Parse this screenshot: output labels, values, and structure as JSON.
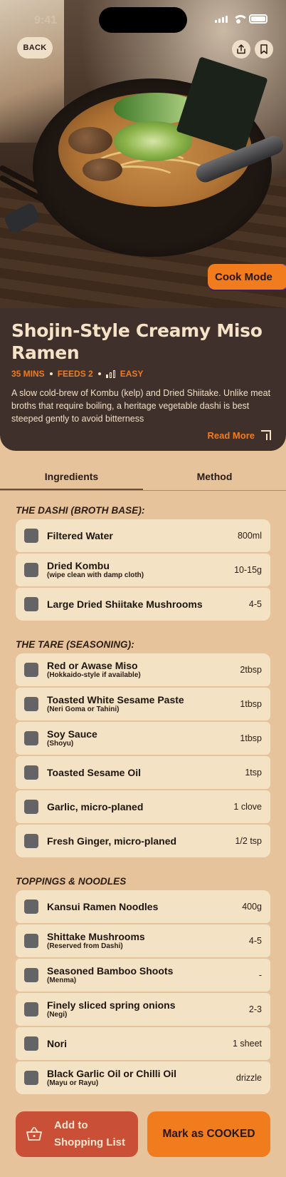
{
  "status_bar": {
    "time": "9:41"
  },
  "header": {
    "back_label": "BACK"
  },
  "hero": {
    "cook_mode_label": "Cook Mode"
  },
  "recipe": {
    "title": "Shojin-Style Creamy Miso Ramen",
    "time": "35 MINS",
    "feeds": "FEEDS 2",
    "difficulty": "EASY",
    "difficulty_level": 1,
    "description": "A slow cold-brew of Kombu (kelp) and Dried Shiitake. Unlike meat broths that require boiling, a heritage vegetable dashi is best steeped gently to avoid bitterness",
    "read_more_label": "Read More"
  },
  "tabs": [
    {
      "label": "Ingredients",
      "active": true
    },
    {
      "label": "Method",
      "active": false
    }
  ],
  "sections": [
    {
      "title": "THE DASHI (BROTH BASE):",
      "items": [
        {
          "name": "Filtered Water",
          "note": "",
          "qty": "800ml"
        },
        {
          "name": "Dried Kombu",
          "note": "(wipe clean with damp cloth)",
          "qty": "10-15g"
        },
        {
          "name": "Large Dried Shiitake Mushrooms",
          "note": "",
          "qty": "4-5"
        }
      ]
    },
    {
      "title": "THE TARE (SEASONING):",
      "items": [
        {
          "name": "Red or Awase Miso",
          "note": "(Hokkaido-style if available)",
          "qty": "2tbsp"
        },
        {
          "name": "Toasted White Sesame Paste",
          "note": "(Neri Goma or Tahini)",
          "qty": "1tbsp"
        },
        {
          "name": "Soy Sauce",
          "note": "(Shoyu)",
          "qty": "1tbsp"
        },
        {
          "name": "Toasted Sesame Oil",
          "note": "",
          "qty": "1tsp"
        },
        {
          "name": "Garlic, micro-planed",
          "note": "",
          "qty": "1 clove"
        },
        {
          "name": "Fresh Ginger, micro-planed",
          "note": "",
          "qty": "1/2 tsp"
        }
      ]
    },
    {
      "title": "TOPPINGS & NOODLES",
      "items": [
        {
          "name": "Kansui Ramen Noodles",
          "note": "",
          "qty": "400g"
        },
        {
          "name": "Shittake Mushrooms",
          "note": "(Reserved from Dashi)",
          "qty": "4-5"
        },
        {
          "name": "Seasoned Bamboo Shoots",
          "note": "(Menma)",
          "qty": "-"
        },
        {
          "name": "Finely sliced spring onions",
          "note": "(Negi)",
          "qty": "2-3"
        },
        {
          "name": "Nori",
          "note": "",
          "qty": "1 sheet"
        },
        {
          "name": "Black Garlic Oil or Chilli Oil",
          "note": "(Mayu or Rayu)",
          "qty": "drizzle"
        }
      ]
    }
  ],
  "actions": {
    "shopping_line1": "Add to",
    "shopping_line2": "Shopping List",
    "cooked_label": "Mark as COOKED"
  },
  "colors": {
    "accent": "#f07c1e",
    "card": "#40302b",
    "background": "#e6c39b",
    "shopping": "#c94f37"
  }
}
